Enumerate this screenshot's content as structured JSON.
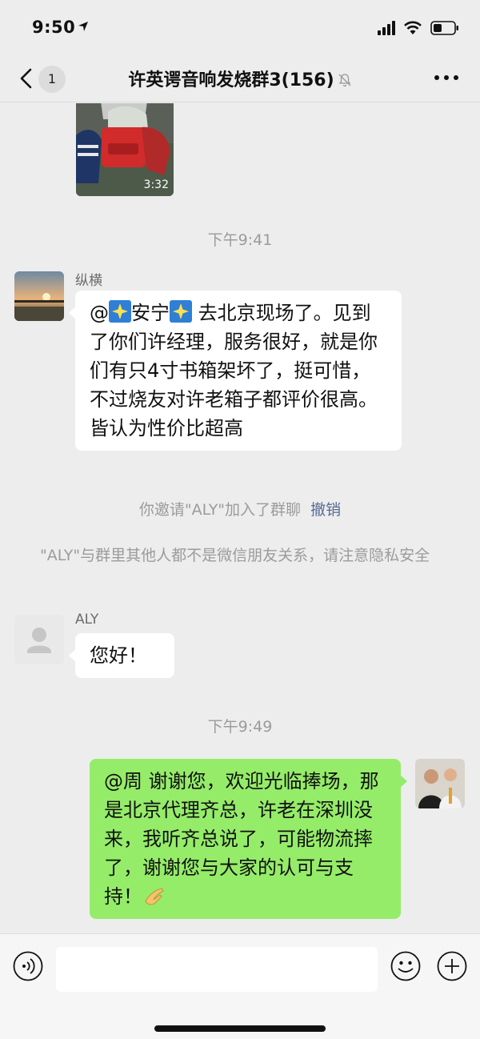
{
  "status_bar": {
    "time": "9:50"
  },
  "nav": {
    "unread_count": "1",
    "title": "许英谔音响发烧群3(156)"
  },
  "chat": {
    "video": {
      "duration": "3:32"
    },
    "timestamp_1": "下午9:41",
    "msg1": {
      "sender": "纵横",
      "prefix": "@",
      "name": "安宁",
      "text": " 去北京现场了。见到了你们许经理，服务很好，就是你们有只4寸书箱架坏了，挺可惜，不过烧友对许老箱子都评价很高。皆认为性价比超高"
    },
    "system_invite": {
      "text": "你邀请\"ALY\"加入了群聊",
      "revoke": "撤销"
    },
    "system_privacy": "\"ALY\"与群里其他人都不是微信朋友关系，请注意隐私安全",
    "msg2": {
      "sender": "ALY",
      "text": "您好！"
    },
    "timestamp_2": "下午9:49",
    "msg3": {
      "text": "@周 谢谢您，欢迎光临捧场，那是北京代理齐总，许老在深圳没来，我听齐总说了，可能物流摔了，谢谢您与大家的认可与支持！"
    }
  },
  "input_bar": {
    "placeholder": ""
  },
  "colors": {
    "outgoing_bubble": "#95ec69",
    "link": "#576b95",
    "background": "#ededed"
  }
}
